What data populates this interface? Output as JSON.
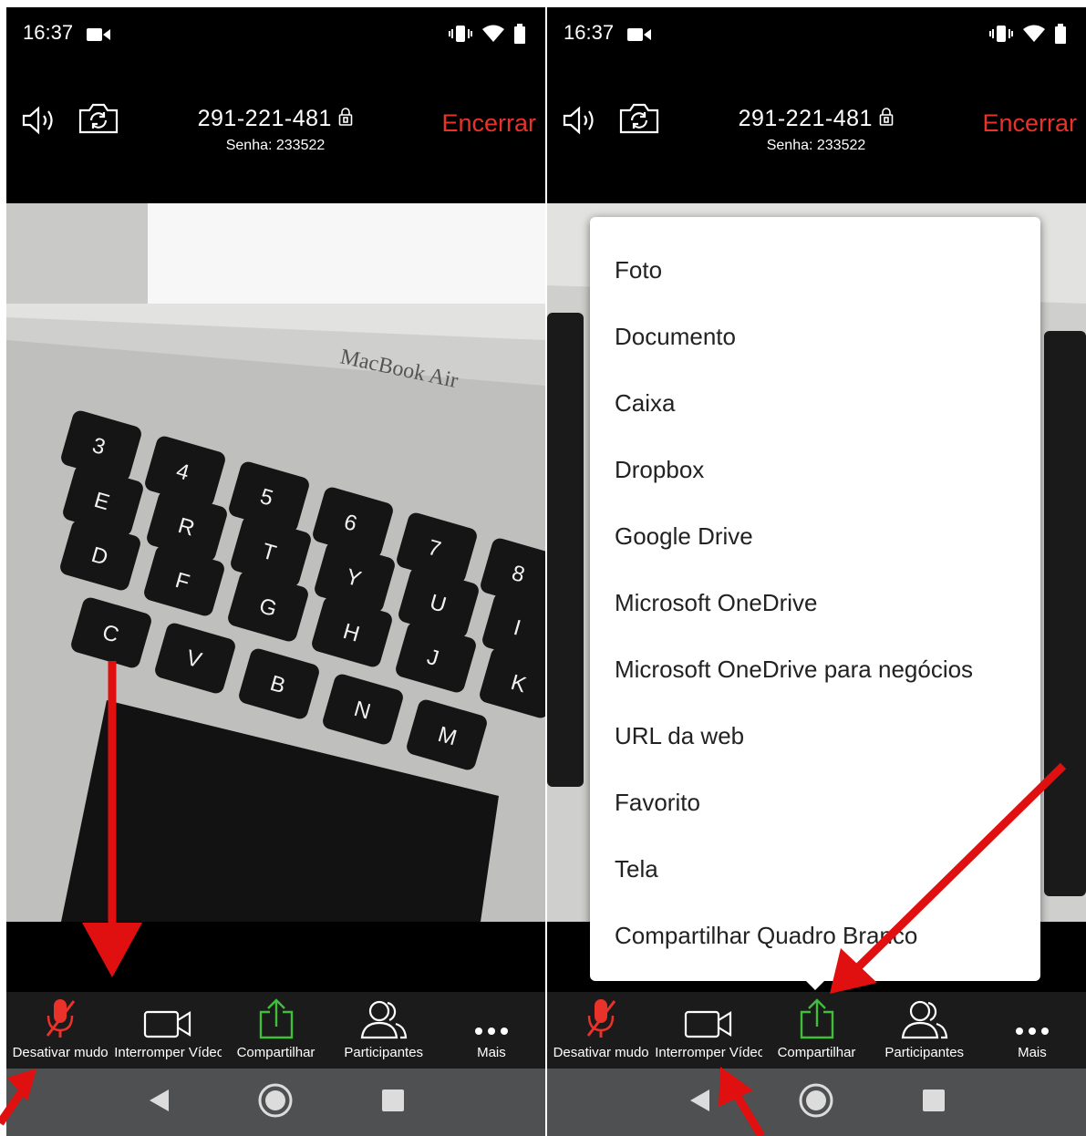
{
  "colors": {
    "accent_red": "#e8322a",
    "share_green": "#3fbf3a",
    "arrow_red": "#e01010",
    "nav_bg": "#4e5051"
  },
  "left": {
    "status": {
      "time": "16:37"
    },
    "meeting": {
      "id": "291-221-481",
      "password": "Senha: 233522",
      "end_label": "Encerrar"
    },
    "video": {
      "brand": "MacBook Air",
      "keys": [
        "3",
        "4",
        "5",
        "6",
        "7",
        "8",
        "E",
        "R",
        "T",
        "Y",
        "U",
        "I",
        "D",
        "F",
        "G",
        "H",
        "J",
        "K",
        "C",
        "V",
        "B",
        "N",
        "M"
      ]
    },
    "toolbar": {
      "mute": "Desativar mudo",
      "video": "Interromper Vídeo",
      "share": "Compartilhar",
      "participants": "Participantes",
      "more": "Mais"
    }
  },
  "right": {
    "status": {
      "time": "16:37"
    },
    "meeting": {
      "id": "291-221-481",
      "password": "Senha: 233522",
      "end_label": "Encerrar"
    },
    "share_menu": [
      "Foto",
      "Documento",
      "Caixa",
      "Dropbox",
      "Google Drive",
      "Microsoft OneDrive",
      "Microsoft OneDrive para negócios",
      "URL da web",
      "Favorito",
      "Tela",
      "Compartilhar Quadro Branco"
    ],
    "toolbar": {
      "mute": "Desativar mudo",
      "video": "Interromper Vídeo",
      "share": "Compartilhar",
      "participants": "Participantes",
      "more": "Mais"
    }
  }
}
